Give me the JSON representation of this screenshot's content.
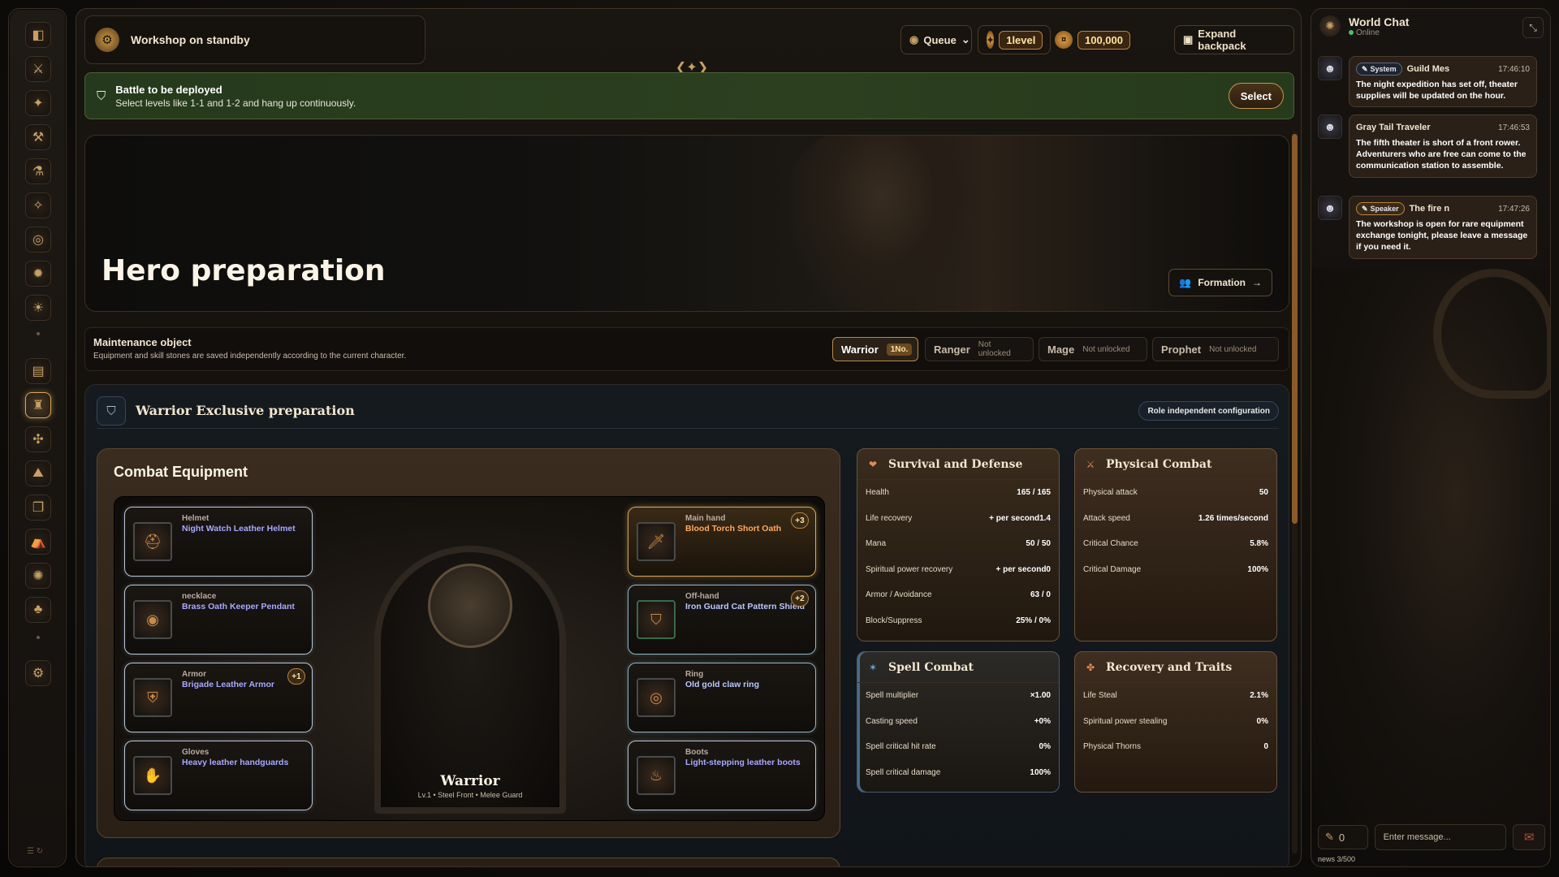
{
  "topbar": {
    "workshop_title": "Workshop on standby",
    "queue_label": "Queue",
    "level_value": "1level",
    "gold_value": "100,000",
    "expand_backpack_label": "Expand backpack"
  },
  "banner": {
    "title": "Battle to be deployed",
    "subtitle": "Select levels like 1-1 and 1-2 and hang up continuously.",
    "select_label": "Select"
  },
  "hero": {
    "title": "Hero preparation",
    "formation_label": "Formation"
  },
  "maintenance": {
    "title": "Maintenance object",
    "subtitle": "Equipment and skill stones are saved independently according to the current character.",
    "roles": [
      {
        "name": "Warrior",
        "status": "1No."
      },
      {
        "name": "Ranger",
        "status": "Not unlocked"
      },
      {
        "name": "Mage",
        "status": "Not unlocked"
      },
      {
        "name": "Prophet",
        "status": "Not unlocked"
      }
    ]
  },
  "preparation": {
    "title": "Warrior Exclusive preparation",
    "role_config_label": "Role independent configuration"
  },
  "combat": {
    "title": "Combat Equipment",
    "character_name": "Warrior",
    "character_sub": "Lv.1 • Steel Front • Melee Guard",
    "slots": [
      {
        "type": "Helmet",
        "name": "Night Watch Leather Helmet",
        "plus": ""
      },
      {
        "type": "necklace",
        "name": "Brass Oath Keeper Pendant",
        "plus": ""
      },
      {
        "type": "Armor",
        "name": "Brigade Leather Armor",
        "plus": "+1"
      },
      {
        "type": "Gloves",
        "name": "Heavy leather handguards",
        "plus": ""
      },
      {
        "type": "Main hand",
        "name": "Blood Torch Short Oath",
        "plus": "+3"
      },
      {
        "type": "Off-hand",
        "name": "Iron Guard Cat Pattern Shield",
        "plus": "+2"
      },
      {
        "type": "Ring",
        "name": "Old gold claw ring",
        "plus": ""
      },
      {
        "type": "Boots",
        "name": "Light-stepping leather boots",
        "plus": ""
      }
    ]
  },
  "stats": {
    "survival": {
      "title": "Survival and Defense",
      "rows": [
        {
          "k": "Health",
          "v": "165 / 165"
        },
        {
          "k": "Life recovery",
          "v": "+ per second1.4"
        },
        {
          "k": "Mana",
          "v": "50 / 50"
        },
        {
          "k": "Spiritual power recovery",
          "v": "+ per second0"
        },
        {
          "k": "Armor / Avoidance",
          "v": "63 / 0"
        },
        {
          "k": "Block/Suppress",
          "v": "25% / 0%"
        }
      ]
    },
    "physical": {
      "title": "Physical Combat",
      "rows": [
        {
          "k": "Physical attack",
          "v": "50"
        },
        {
          "k": "Attack speed",
          "v": "1.26 times/second"
        },
        {
          "k": "Critical Chance",
          "v": "5.8%"
        },
        {
          "k": "Critical Damage",
          "v": "100%"
        }
      ]
    },
    "spell": {
      "title": "Spell Combat",
      "rows": [
        {
          "k": "Spell multiplier",
          "v": "×1.00"
        },
        {
          "k": "Casting speed",
          "v": "+0%"
        },
        {
          "k": "Spell critical hit rate",
          "v": "0%"
        },
        {
          "k": "Spell critical damage",
          "v": "100%"
        }
      ]
    },
    "recovery": {
      "title": "Recovery and Traits",
      "rows": [
        {
          "k": "Life Steal",
          "v": "2.1%"
        },
        {
          "k": "Spiritual power stealing",
          "v": "0%"
        },
        {
          "k": "Physical Thorns",
          "v": "0"
        }
      ]
    }
  },
  "chat": {
    "title": "World Chat",
    "status": "Online",
    "messages": [
      {
        "badge": "System",
        "name": "Guild Mes",
        "time": "17:46:10",
        "text": "The night expedition has set off, theater supplies will be updated on the hour."
      },
      {
        "badge": "",
        "name": "Gray Tail Traveler",
        "time": "17:46:53",
        "text": "The fifth theater is short of a front rower. Adventurers who are free can come to the communication station to assemble."
      },
      {
        "badge": "Speaker",
        "name": "The fire n",
        "time": "17:47:26",
        "text": "The workshop is open for rare equipment exchange tonight, please leave a message if you need it."
      }
    ],
    "trumpet_count": "0",
    "input_placeholder": "Enter message...",
    "news_count": "news 3/500"
  },
  "colors": {
    "accent_gold": "#d8a85a",
    "banner_green": "#2c4020",
    "rare_blue": "#a8a8ff",
    "epic_orange": "#ffa860"
  }
}
